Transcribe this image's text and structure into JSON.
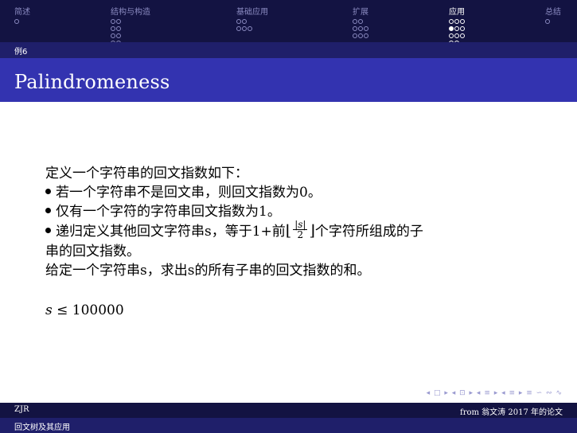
{
  "nav": {
    "sections": [
      {
        "label": "简述",
        "dots": [
          [
            0
          ]
        ],
        "active": false
      },
      {
        "label": "结构与构造",
        "dots": [
          [
            0,
            0
          ],
          [
            0,
            0
          ],
          [
            0,
            0
          ],
          [
            0,
            0
          ]
        ],
        "active": false
      },
      {
        "label": "基础应用",
        "dots": [
          [
            0,
            0
          ],
          [
            0,
            0,
            0
          ]
        ],
        "active": false
      },
      {
        "label": "扩展",
        "dots": [
          [
            0,
            0
          ],
          [
            0,
            0,
            0
          ],
          [
            0,
            0,
            0
          ]
        ],
        "active": false
      },
      {
        "label": "应用",
        "dots": [
          [
            0,
            0,
            0
          ],
          [
            1,
            0,
            0
          ],
          [
            0,
            0,
            0
          ],
          [
            0,
            0
          ]
        ],
        "active": true
      },
      {
        "label": "总结",
        "dots": [
          [
            0
          ]
        ],
        "active": false
      }
    ]
  },
  "subsection": "例6",
  "title": "Palindromeness",
  "content": {
    "intro": "定义一个字符串的回文指数如下：",
    "bullet1": "若一个字符串不是回文串，则回文指数为0。",
    "bullet2": "仅有一个字符的字符串回文指数为1。",
    "bullet3_a": "递归定义其他回文字符串s，等于1+前",
    "frac_num": "|s|",
    "frac_den": "2",
    "bullet3_b": "个字符所组成的子",
    "bullet3_c": "串的回文指数。",
    "question": "给定一个字符串s，求出s的所有子串的回文指数的和。",
    "constraint_var": "s",
    "constraint_rest": " ≤ 100000"
  },
  "nav_symbols": "◂ □ ▸  ◂ ⊡ ▸  ◂ ≡ ▸  ◂ ≡ ▸   ≡   ∽ ∾ ∿",
  "footer": {
    "author": "ZJR",
    "source": "from 翁文涛 2017 年的论文",
    "talk_title": "回文树及其应用"
  }
}
